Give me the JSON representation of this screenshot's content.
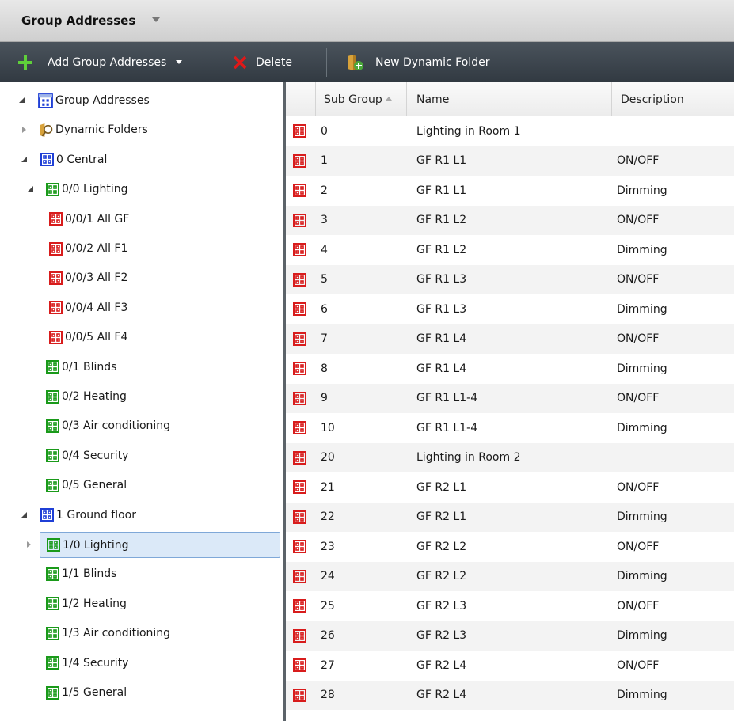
{
  "window": {
    "title": "Group Addresses"
  },
  "toolbar": {
    "add_label": "Add Group Addresses",
    "delete_label": "Delete",
    "new_dynamic_folder_label": "New Dynamic Folder"
  },
  "tree": {
    "root": "Group Addresses",
    "items": [
      {
        "label": "Dynamic Folders"
      },
      {
        "label": "0 Central"
      },
      {
        "label": "0/0 Lighting"
      },
      {
        "label": "0/0/1 All GF"
      },
      {
        "label": "0/0/2 All F1"
      },
      {
        "label": "0/0/3 All F2"
      },
      {
        "label": "0/0/4 All F3"
      },
      {
        "label": "0/0/5 All F4"
      },
      {
        "label": "0/1 Blinds"
      },
      {
        "label": "0/2 Heating"
      },
      {
        "label": "0/3 Air conditioning"
      },
      {
        "label": "0/4 Security"
      },
      {
        "label": "0/5 General"
      },
      {
        "label": "1 Ground floor"
      },
      {
        "label": "1/0 Lighting"
      },
      {
        "label": "1/1 Blinds"
      },
      {
        "label": "1/2 Heating"
      },
      {
        "label": "1/3 Air conditioning"
      },
      {
        "label": "1/4 Security"
      },
      {
        "label": "1/5 General"
      }
    ]
  },
  "grid": {
    "columns": {
      "sub_group": "Sub Group",
      "name": "Name",
      "description": "Description"
    },
    "rows": [
      {
        "sub_group": "0",
        "name": "Lighting in Room 1",
        "description": ""
      },
      {
        "sub_group": "1",
        "name": "GF R1 L1",
        "description": "ON/OFF"
      },
      {
        "sub_group": "2",
        "name": "GF R1 L1",
        "description": "Dimming"
      },
      {
        "sub_group": "3",
        "name": "GF R1 L2",
        "description": "ON/OFF"
      },
      {
        "sub_group": "4",
        "name": "GF R1 L2",
        "description": "Dimming"
      },
      {
        "sub_group": "5",
        "name": "GF R1 L3",
        "description": "ON/OFF"
      },
      {
        "sub_group": "6",
        "name": "GF R1 L3",
        "description": "Dimming"
      },
      {
        "sub_group": "7",
        "name": "GF R1 L4",
        "description": "ON/OFF"
      },
      {
        "sub_group": "8",
        "name": "GF R1 L4",
        "description": "Dimming"
      },
      {
        "sub_group": "9",
        "name": "GF R1 L1-4",
        "description": "ON/OFF"
      },
      {
        "sub_group": "10",
        "name": "GF R1 L1-4",
        "description": "Dimming"
      },
      {
        "sub_group": "20",
        "name": "Lighting in Room 2",
        "description": ""
      },
      {
        "sub_group": "21",
        "name": "GF R2 L1",
        "description": "ON/OFF"
      },
      {
        "sub_group": "22",
        "name": "GF R2 L1",
        "description": "Dimming"
      },
      {
        "sub_group": "23",
        "name": "GF R2 L2",
        "description": "ON/OFF"
      },
      {
        "sub_group": "24",
        "name": "GF R2 L2",
        "description": "Dimming"
      },
      {
        "sub_group": "25",
        "name": "GF R2 L3",
        "description": "ON/OFF"
      },
      {
        "sub_group": "26",
        "name": "GF R2 L3",
        "description": "Dimming"
      },
      {
        "sub_group": "27",
        "name": "GF R2 L4",
        "description": "ON/OFF"
      },
      {
        "sub_group": "28",
        "name": "GF R2 L4",
        "description": "Dimming"
      }
    ]
  },
  "colors": {
    "main_group_icon": "#1f3fd6",
    "middle_group_icon": "#1a9a1a",
    "group_address_icon": "#d81c1c",
    "toolbar_bg": "#3c444c",
    "selection": "#dbe9f8"
  }
}
